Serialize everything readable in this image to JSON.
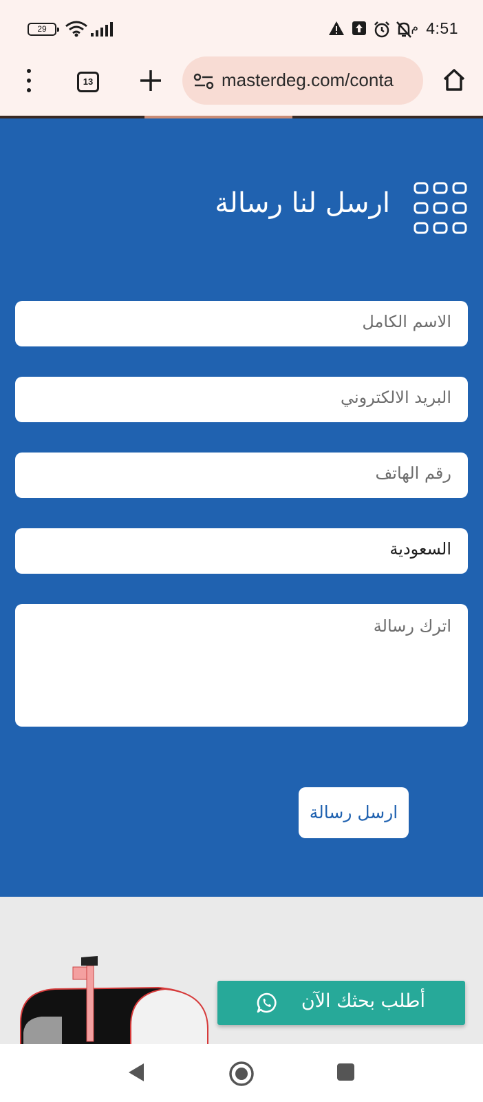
{
  "status_bar": {
    "time": "4:51",
    "ampm": "م",
    "battery": "29",
    "icons": [
      "wifi-icon",
      "signal-icon",
      "warning-icon",
      "upload-icon",
      "alarm-icon",
      "notifications-off-icon"
    ]
  },
  "browser": {
    "url": "masterdeg.com/conta",
    "tab_count": "13"
  },
  "contact_section": {
    "heading": "ارسل لنا رسالة",
    "heading_icon": "grid-icon",
    "fields": {
      "full_name": "الاسم الكامل",
      "email": "البريد الالكتروني",
      "phone": "رقم الهاتف",
      "country": "السعودية",
      "message": "اترك رسالة"
    },
    "submit_label": "ارسل رسالة"
  },
  "whatsapp_cta": {
    "label": "أطلب بحثك الآن",
    "icon": "whatsapp-icon"
  },
  "colors": {
    "section_blue": "#2062b0",
    "whatsapp_green": "#27a999",
    "browser_bar": "#fdf2ef",
    "url_pill": "#f8dcd4"
  }
}
